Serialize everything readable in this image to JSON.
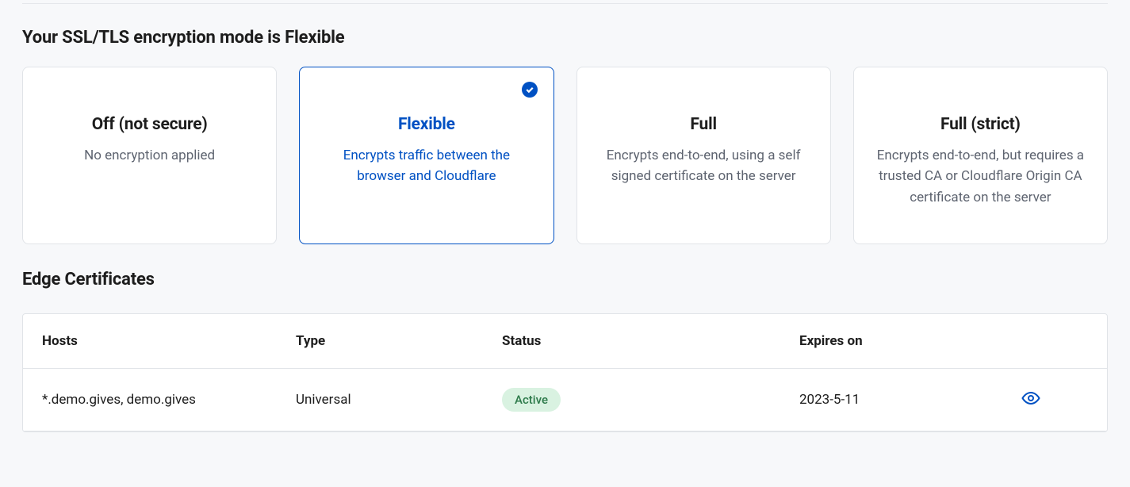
{
  "sslSection": {
    "title": "Your SSL/TLS encryption mode is Flexible",
    "options": [
      {
        "title": "Off (not secure)",
        "desc": "No encryption applied",
        "selected": false
      },
      {
        "title": "Flexible",
        "desc": "Encrypts traffic between the browser and Cloudflare",
        "selected": true
      },
      {
        "title": "Full",
        "desc": "Encrypts end-to-end, using a self signed certificate on the server",
        "selected": false
      },
      {
        "title": "Full (strict)",
        "desc": "Encrypts end-to-end, but requires a trusted CA or Cloudflare Origin CA certificate on the server",
        "selected": false
      }
    ]
  },
  "edgeSection": {
    "title": "Edge Certificates",
    "headers": {
      "hosts": "Hosts",
      "type": "Type",
      "status": "Status",
      "expires": "Expires on"
    },
    "rows": [
      {
        "hosts": "*.demo.gives, demo.gives",
        "type": "Universal",
        "status": "Active",
        "expires": "2023-5-11"
      }
    ]
  }
}
